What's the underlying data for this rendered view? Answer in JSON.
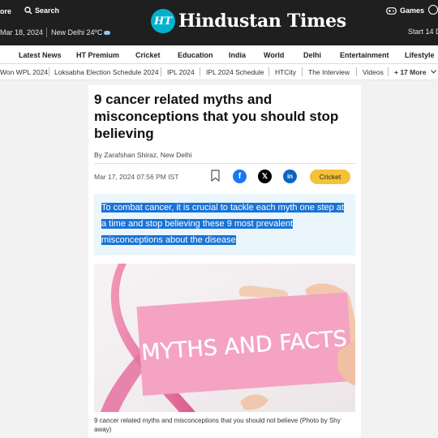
{
  "header": {
    "more_label": "ore",
    "search_label": "Search",
    "date": "Mar 18, 2024",
    "weather": "New Delhi 24ºC",
    "logo_badge": "HT",
    "logo_name": "Hindustan Times",
    "games_label": "Games",
    "start_label": "Start 14 D"
  },
  "nav_primary": [
    "Latest News",
    "HT Premium",
    "Cricket",
    "Education",
    "India",
    "World",
    "Delhi",
    "Entertainment",
    "Lifestyle"
  ],
  "nav_secondary": [
    "Won WPL 2024",
    "Loksabha Election Schedule 2024",
    "IPL 2024",
    "IPL 2024 Schedule",
    "HTCity",
    "The Interview",
    "Videos",
    "+ 17 More"
  ],
  "article": {
    "headline": "9 cancer related myths and misconceptions that you should stop believing",
    "byline": "By Zarafshan Shiraz, New Delhi",
    "published": "Mar 17, 2024 07:56 PM IST",
    "tag": "Cricket",
    "summary": "To combat cancer, it is crucial to tackle each myth one step at a time and stop believing these 9 most prevalent misconceptions about the disease",
    "image_text": "MYTHS AND FACTS",
    "caption": "9 cancer related myths and misconceptions that you should not believe (Photo by Shy away)"
  },
  "share": {
    "facebook": "f",
    "x": "𝕏",
    "linkedin": "in"
  },
  "colors": {
    "header_bg": "#1f1f1f",
    "logo_badge": "#00b1cd",
    "selection": "#1a73d6",
    "tag": "#f6c136",
    "ribbon": "#e8699a"
  }
}
